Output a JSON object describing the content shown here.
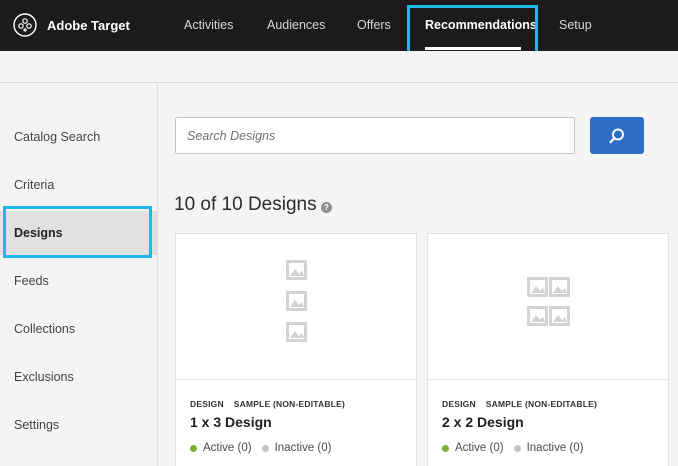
{
  "app": {
    "name": "Adobe Target"
  },
  "nav": {
    "items": [
      {
        "label": "Activities"
      },
      {
        "label": "Audiences"
      },
      {
        "label": "Offers"
      },
      {
        "label": "Recommendations"
      },
      {
        "label": "Setup"
      }
    ],
    "active": "Recommendations"
  },
  "sidebar": {
    "items": [
      {
        "label": "Catalog Search"
      },
      {
        "label": "Criteria"
      },
      {
        "label": "Designs"
      },
      {
        "label": "Feeds"
      },
      {
        "label": "Collections"
      },
      {
        "label": "Exclusions"
      },
      {
        "label": "Settings"
      }
    ],
    "active": "Designs"
  },
  "search": {
    "placeholder": "Search Designs",
    "value": "",
    "button_icon": "search-icon"
  },
  "designs": {
    "count_label": "10 of 10 Designs",
    "help_icon": "question-icon",
    "cards": [
      {
        "type_label": "DESIGN",
        "sample_label": "SAMPLE (NON-EDITABLE)",
        "name": "1 x 3 Design",
        "active_label": "Active (0)",
        "inactive_label": "Inactive (0)",
        "thumbnail_icon": "image-placeholder-icon"
      },
      {
        "type_label": "DESIGN",
        "sample_label": "SAMPLE (NON-EDITABLE)",
        "name": "2 x 2 Design",
        "active_label": "Active (0)",
        "inactive_label": "Inactive (0)",
        "thumbnail_icon": "image-placeholder-icon"
      }
    ]
  },
  "colors": {
    "topbar_bg": "#1b1b1b",
    "highlight": "#1fb8e8",
    "primary_button": "#2d6ec9",
    "status_active": "#7ab03a",
    "status_inactive": "#c4c4c4"
  }
}
